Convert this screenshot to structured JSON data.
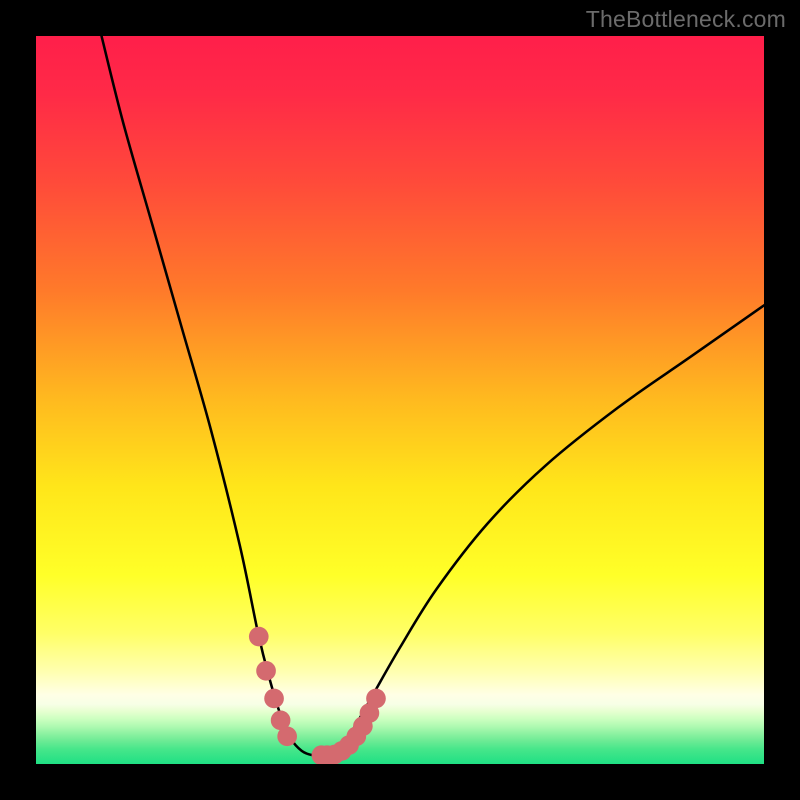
{
  "watermark": "TheBottleneck.com",
  "chart_data": {
    "type": "line",
    "title": "",
    "xlabel": "",
    "ylabel": "",
    "xlim": [
      0,
      100
    ],
    "ylim": [
      0,
      100
    ],
    "series": [
      {
        "name": "curve",
        "x": [
          9,
          12,
          16,
          20,
          24,
          28,
          30.5,
          32,
          33.5,
          35,
          36.5,
          38,
          39.5,
          41,
          42.5,
          44,
          46,
          50,
          55,
          62,
          70,
          80,
          90,
          100
        ],
        "y": [
          100,
          88,
          74,
          60,
          46,
          30,
          18,
          12,
          7,
          3.5,
          1.8,
          1.2,
          1.2,
          1.8,
          3.2,
          5.5,
          9,
          16,
          24,
          33,
          41,
          49,
          56,
          63
        ]
      }
    ],
    "markers": {
      "name": "highlight-dots",
      "color": "#d46a6f",
      "x": [
        30.6,
        31.6,
        32.7,
        33.6,
        34.5,
        39.2,
        40.0,
        41.0,
        42.0,
        43.0,
        44.0,
        44.9,
        45.8,
        46.7
      ],
      "y": [
        17.5,
        12.8,
        9.0,
        6.0,
        3.8,
        1.2,
        1.2,
        1.3,
        1.8,
        2.6,
        3.8,
        5.2,
        7.0,
        9.0
      ]
    },
    "background_gradient": [
      {
        "pos": 0.0,
        "color": "#ff1f4a"
      },
      {
        "pos": 0.08,
        "color": "#ff2a47"
      },
      {
        "pos": 0.2,
        "color": "#ff4a3a"
      },
      {
        "pos": 0.35,
        "color": "#ff7a2a"
      },
      {
        "pos": 0.5,
        "color": "#ffba1f"
      },
      {
        "pos": 0.62,
        "color": "#ffe61a"
      },
      {
        "pos": 0.74,
        "color": "#ffff28"
      },
      {
        "pos": 0.82,
        "color": "#ffff66"
      },
      {
        "pos": 0.873,
        "color": "#ffffb0"
      },
      {
        "pos": 0.905,
        "color": "#ffffe6"
      },
      {
        "pos": 0.918,
        "color": "#f7ffe6"
      },
      {
        "pos": 0.928,
        "color": "#e6ffd0"
      },
      {
        "pos": 0.938,
        "color": "#ccffc0"
      },
      {
        "pos": 0.948,
        "color": "#b0fab2"
      },
      {
        "pos": 0.958,
        "color": "#8ef2a2"
      },
      {
        "pos": 0.968,
        "color": "#6deb95"
      },
      {
        "pos": 0.98,
        "color": "#46e68a"
      },
      {
        "pos": 1.0,
        "color": "#1fe084"
      }
    ]
  }
}
